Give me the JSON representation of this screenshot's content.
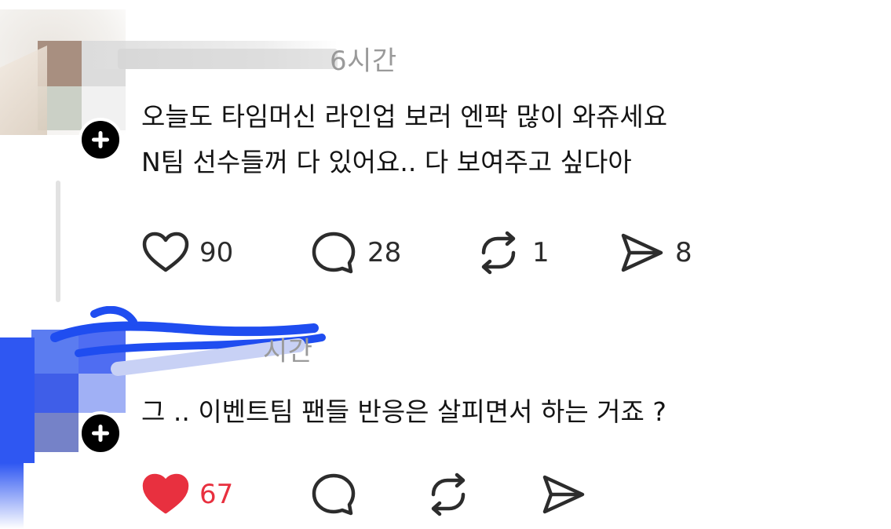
{
  "posts": [
    {
      "meta_time": "6시간",
      "lines": [
        "오늘도 타임머신 라인업 보러 엔팍 많이 와쥬세요",
        "N팀 선수들꺼 다 있어요.. 다 보여주고 싶다아"
      ],
      "actions": {
        "like_count": "90",
        "reply_count": "28",
        "repost_count": "1",
        "share_count": "8",
        "liked": false
      }
    },
    {
      "meta_time": "시간",
      "lines": [
        "그 .. 이벤트팀 팬들 반응은 살피면서 하는 거죠 ?"
      ],
      "actions": {
        "like_count": "67",
        "liked": true
      }
    }
  ],
  "colors": {
    "like_active": "#e8303f",
    "icon": "#2c2c2c",
    "meta": "#9a9a9a",
    "redaction_blue": "#1f4df0"
  },
  "icons": [
    "heart-icon",
    "reply-icon",
    "repost-icon",
    "share-icon",
    "plus-icon"
  ]
}
